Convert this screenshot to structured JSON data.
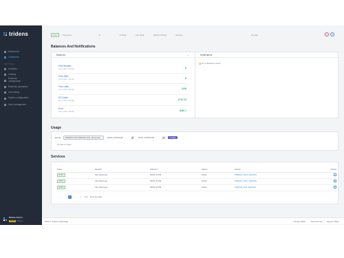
{
  "app": {
    "name": "tridens"
  },
  "sidebar": {
    "items_top": [
      {
        "label": "Dashboard",
        "icon": "dashboard-icon",
        "active": false
      },
      {
        "label": "Customers",
        "icon": "users-icon",
        "active": true
      }
    ],
    "section_label": "SETTINGS",
    "items_bottom": [
      {
        "label": "Analytics",
        "icon": "chart-icon"
      },
      {
        "label": "Catalog",
        "icon": "catalog-icon"
      },
      {
        "label": "Business configuration",
        "icon": "briefcase-icon"
      },
      {
        "label": "Business operations",
        "icon": "operations-icon"
      },
      {
        "label": "Accounting",
        "icon": "accounting-icon"
      },
      {
        "label": "System configuration",
        "icon": "gear-icon"
      },
      {
        "label": "User management",
        "icon": "user-management-icon"
      }
    ],
    "user": {
      "name": "Mobile Admin",
      "role": "ADMIN",
      "meta": "Tridens ▾"
    }
  },
  "top_strip": {
    "tag": "Active",
    "cells": [
      "Group Fee",
      "$",
      "N. Build",
      "Dec 2019",
      "$35.00, 00 PM",
      "Monthly",
      "Prepaid"
    ]
  },
  "balances_section": {
    "title": "Balances And Notifications"
  },
  "balances_card": {
    "header": "Balances",
    "rows": [
      {
        "label": "Free Minutes",
        "date": "Jan 9, 2020 · Monthly",
        "value": "0"
      },
      {
        "label": "Free SMS",
        "date": "Jan 9, 2020 · Monthly",
        "value": "0"
      },
      {
        "label": "Free Units",
        "date": "Jan 9, 2020 · Monthly",
        "value": "-100"
      },
      {
        "label": "US Dollar",
        "date": "Jan 9, 2020 · Monthly",
        "value": "274.70"
      },
      {
        "label": "Euro",
        "date": "Jan 9, 2020 · Monthly",
        "value": "336.7"
      }
    ]
  },
  "notifications_card": {
    "header": "Notifications",
    "empty_text": "No notifications found"
  },
  "usage_section": {
    "title": "Usage"
  },
  "usage": {
    "events_label": "Events",
    "event_value": "PREPAID DATA SERVICE (S10_Shortcode) ×",
    "from_date": "1/1/20, 12:00:00 AM",
    "to_date": "1/1/20, 11:59:59 PM",
    "apply_label": "Apply",
    "empty_text": "No data to display"
  },
  "services_section": {
    "title": "Services"
  },
  "services": {
    "columns": [
      "Status",
      "Identifier",
      "Valid from",
      "Valid to",
      "Service",
      "Actions"
    ],
    "rows": [
      {
        "status": "Active",
        "identifier": "S10_Shortcode",
        "from": "8/5/20, 00 PM",
        "to": "Infinite",
        "service": "PREPAID_DATA_SERVICE"
      },
      {
        "status": "Active",
        "identifier": "S10_Shortcode",
        "from": "8/5/20, 00 PM",
        "to": "Infinite",
        "service": "PREPAID_DATA_SERVICE"
      },
      {
        "status": "Active",
        "identifier": "S10_Shortcode",
        "from": "8/5/20, 00 PM",
        "to": "Infinite",
        "service": "PREPAID_SMS_SERVICE"
      }
    ],
    "pager": {
      "prev": "‹",
      "page": "1",
      "next": "›",
      "last": "»",
      "size": "10 ▾",
      "per_page": "items per page"
    }
  },
  "footer": {
    "copyright": "2020 © Tridens Technology",
    "links": [
      "Privacy Policy",
      "Terms Of Use",
      "Report A Bug"
    ]
  },
  "colors": {
    "sidebar": "#232b38",
    "accent": "#3fa2ff",
    "value_green": "#2aa27b",
    "apply": "#5b57d6"
  }
}
